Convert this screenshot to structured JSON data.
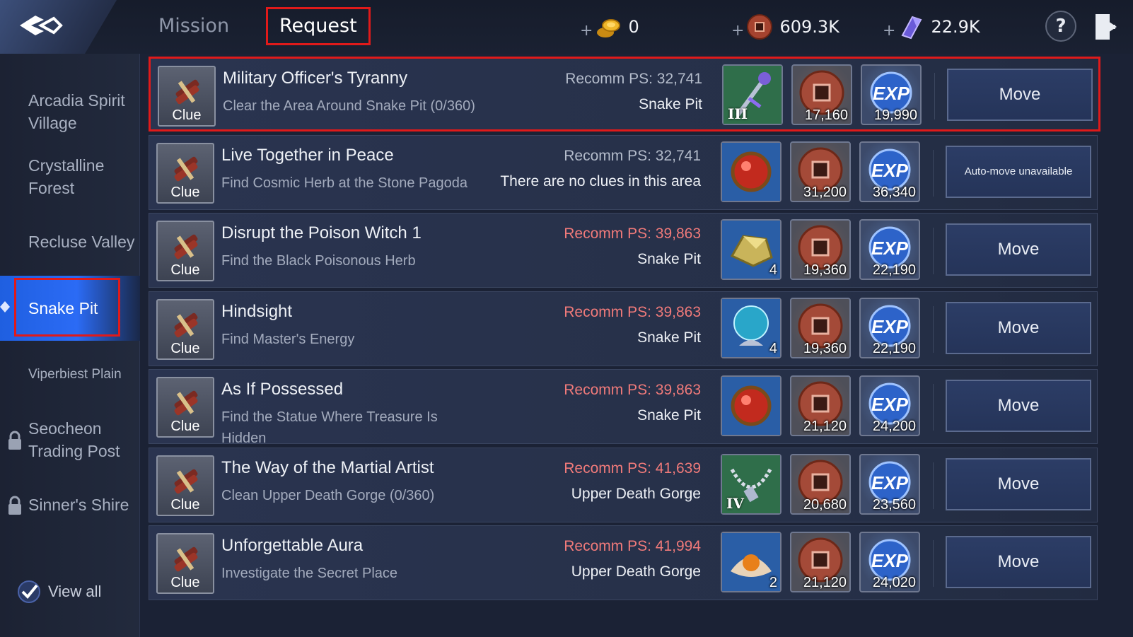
{
  "header": {
    "tabs": [
      {
        "label": "Mission",
        "active": false
      },
      {
        "label": "Request",
        "active": true
      }
    ],
    "currencies": [
      {
        "icon": "gold-coins-icon",
        "value": "0"
      },
      {
        "icon": "bronze-coin-icon",
        "value": "609.3K"
      },
      {
        "icon": "crystal-icon",
        "value": "22.9K"
      }
    ],
    "help_label": "?"
  },
  "sidebar": {
    "items": [
      {
        "label": "Arcadia Spirit Village",
        "locked": false,
        "active": false
      },
      {
        "label": "Crystalline Forest",
        "locked": false,
        "active": false
      },
      {
        "label": "Recluse Valley",
        "locked": false,
        "active": false
      },
      {
        "label": "Snake Pit",
        "locked": false,
        "active": true
      },
      {
        "label": "Viperbiest Plain",
        "locked": false,
        "active": false
      },
      {
        "label": "Seocheon Trading Post",
        "locked": true,
        "active": false
      },
      {
        "label": "Sinner's Shire",
        "locked": true,
        "active": false
      }
    ],
    "view_all_label": "View all",
    "view_all_checked": true
  },
  "quests": [
    {
      "clue": "Clue",
      "title": "Military Officer's Tyranny",
      "desc": "Clear the Area Around Snake Pit (0/360)",
      "ps": "Recomm PS: 32,741",
      "ps_warning": false,
      "location": "Snake Pit",
      "item": {
        "icon": "staff-icon",
        "count": "",
        "tier": "III"
      },
      "coin": "17,160",
      "exp": "19,990",
      "action": "Move"
    },
    {
      "clue": "Clue",
      "title": "Live Together in Peace",
      "desc": "Find Cosmic Herb at the Stone Pagoda",
      "ps": "Recomm PS: 32,741",
      "ps_warning": false,
      "location": "There are no clues in this area",
      "item": {
        "icon": "red-orb-icon",
        "count": "",
        "tier": ""
      },
      "coin": "31,200",
      "exp": "36,340",
      "action": "Auto-move unavailable"
    },
    {
      "clue": "Clue",
      "title": "Disrupt the Poison Witch 1",
      "desc": "Find the Black Poisonous Herb",
      "ps": "Recomm PS: 39,863",
      "ps_warning": true,
      "location": "Snake Pit",
      "item": {
        "icon": "gold-ore-icon",
        "count": "4",
        "tier": ""
      },
      "coin": "19,360",
      "exp": "22,190",
      "action": "Move"
    },
    {
      "clue": "Clue",
      "title": "Hindsight",
      "desc": "Find Master's Energy",
      "ps": "Recomm PS: 39,863",
      "ps_warning": true,
      "location": "Snake Pit",
      "item": {
        "icon": "crystal-ball-icon",
        "count": "4",
        "tier": ""
      },
      "coin": "19,360",
      "exp": "22,190",
      "action": "Move"
    },
    {
      "clue": "Clue",
      "title": "As If Possessed",
      "desc": "Find the Statue Where Treasure Is Hidden",
      "ps": "Recomm PS: 39,863",
      "ps_warning": true,
      "location": "Snake Pit",
      "item": {
        "icon": "red-orb-icon",
        "count": "",
        "tier": ""
      },
      "coin": "21,120",
      "exp": "24,200",
      "action": "Move"
    },
    {
      "clue": "Clue",
      "title": "The Way of the Martial Artist",
      "desc": "Clean Upper Death Gorge (0/360)",
      "ps": "Recomm PS: 41,639",
      "ps_warning": true,
      "location": "Upper Death Gorge",
      "item": {
        "icon": "necklace-icon",
        "count": "",
        "tier": "IV"
      },
      "coin": "20,680",
      "exp": "23,560",
      "action": "Move"
    },
    {
      "clue": "Clue",
      "title": "Unforgettable Aura",
      "desc": "Investigate the Secret Place",
      "ps": "Recomm PS: 41,994",
      "ps_warning": true,
      "location": "Upper Death Gorge",
      "item": {
        "icon": "pearl-icon",
        "count": "2",
        "tier": ""
      },
      "coin": "21,120",
      "exp": "24,020",
      "action": "Move"
    }
  ],
  "colors": {
    "accent_blue": "#2b6bf5",
    "highlight_red": "#e01a1a",
    "warning_ps": "#f07a7a"
  }
}
